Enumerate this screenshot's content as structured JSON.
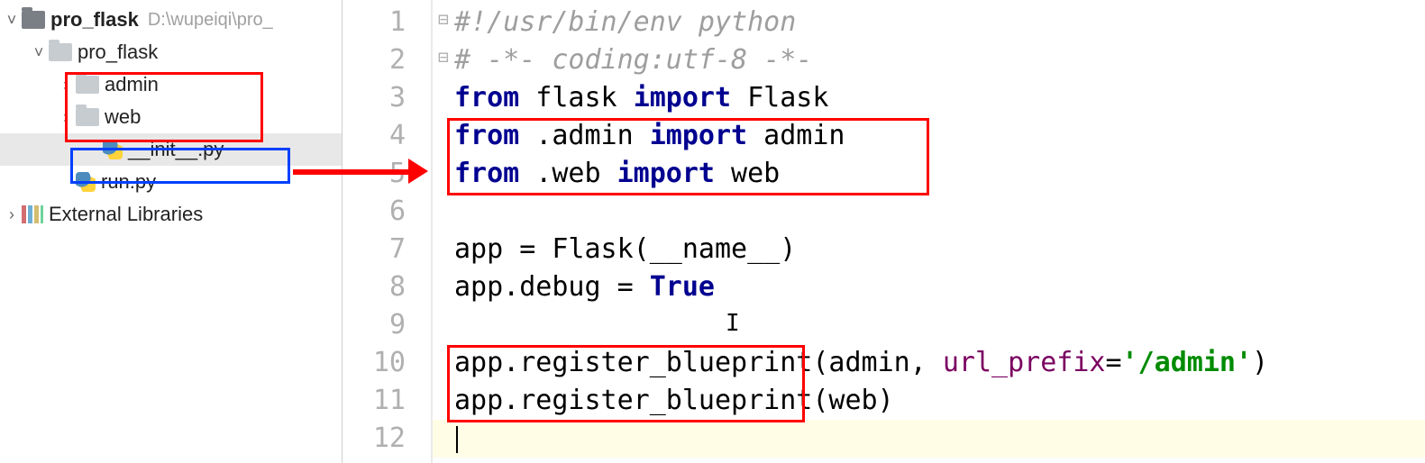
{
  "tree": {
    "root": {
      "label": "pro_flask",
      "path": "D:\\wupeiqi\\pro_"
    },
    "pkg": {
      "label": "pro_flask"
    },
    "admin": {
      "label": "admin"
    },
    "web": {
      "label": "web"
    },
    "init": {
      "label": "__init__.py"
    },
    "run": {
      "label": "run.py"
    },
    "extlib": {
      "label": "External Libraries"
    }
  },
  "gutter": [
    "1",
    "2",
    "3",
    "4",
    "5",
    "6",
    "7",
    "8",
    "9",
    "10",
    "11",
    "12"
  ],
  "code": {
    "l1": {
      "cm": "#!/usr/bin/env python"
    },
    "l2": {
      "cm": "# -*- coding:utf-8 -*-"
    },
    "l3": {
      "kw1": "from",
      "mid": " flask ",
      "kw2": "import",
      "end": " Flask"
    },
    "l4": {
      "kw1": "from",
      "mid": " .admin ",
      "kw2": "import",
      "end": " admin"
    },
    "l5": {
      "kw1": "from",
      "mid": " .web ",
      "kw2": "import",
      "end": " web"
    },
    "l7": {
      "txt": "app = Flask(__name__)"
    },
    "l8": {
      "pre": "app.debug = ",
      "kw": "True"
    },
    "l10": {
      "call": "app.register_blueprint",
      "open": "(",
      "a1": "admin",
      "sep": ", ",
      "kwarg": "url_prefix",
      "eq": "=",
      "str": "'/admin'",
      "close": ")"
    },
    "l11": {
      "call": "app.register_blueprint",
      "open": "(",
      "a1": "web",
      "close": ")"
    }
  }
}
